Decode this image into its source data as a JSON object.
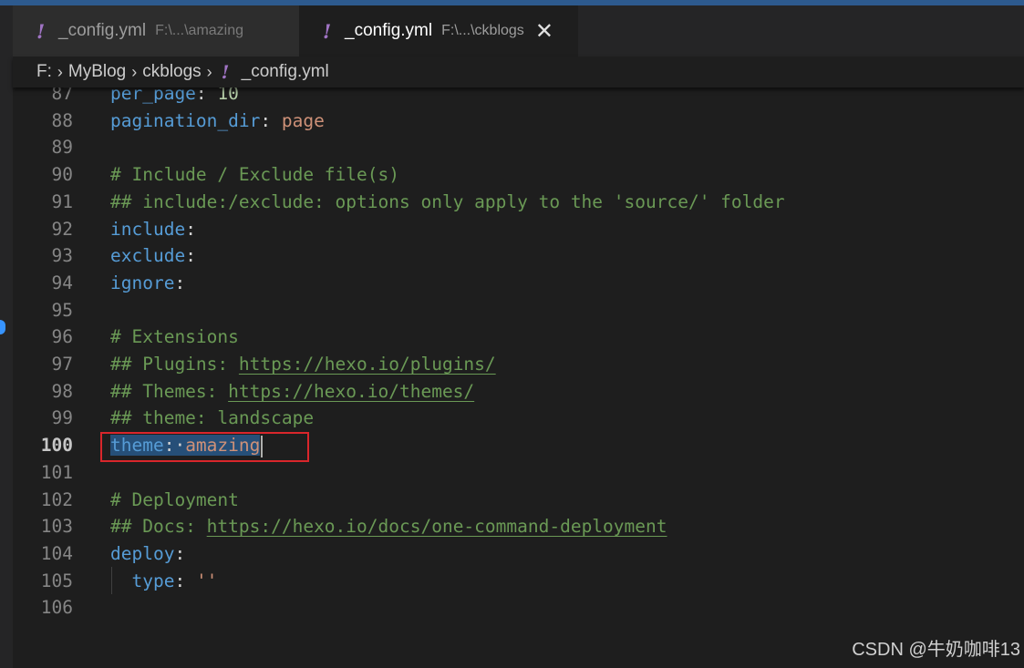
{
  "tabs": [
    {
      "name": "_config.yml",
      "description": "F:\\...\\amazing",
      "active": false
    },
    {
      "name": "_config.yml",
      "description": "F:\\...\\ckblogs",
      "active": true
    }
  ],
  "tab_close_glyph": "✕",
  "yml_icon_glyph": "!",
  "breadcrumb": {
    "items": [
      "F:",
      "MyBlog",
      "ckblogs"
    ],
    "file": "_config.yml",
    "separator": "›"
  },
  "editor": {
    "current_line": "100",
    "lines": [
      {
        "num": "87",
        "code": [
          {
            "t": "per_page",
            "c": "k"
          },
          {
            "t": ": ",
            "c": "p"
          },
          {
            "t": "10",
            "c": "n"
          }
        ]
      },
      {
        "num": "88",
        "code": [
          {
            "t": "pagination_dir",
            "c": "k"
          },
          {
            "t": ": ",
            "c": "p"
          },
          {
            "t": "page",
            "c": "s"
          }
        ]
      },
      {
        "num": "89",
        "code": []
      },
      {
        "num": "90",
        "code": [
          {
            "t": "# Include / Exclude file(s)",
            "c": "c"
          }
        ]
      },
      {
        "num": "91",
        "code": [
          {
            "t": "## include:/exclude: options only apply to the 'source/' folder",
            "c": "c"
          }
        ]
      },
      {
        "num": "92",
        "code": [
          {
            "t": "include",
            "c": "k"
          },
          {
            "t": ":",
            "c": "p"
          }
        ]
      },
      {
        "num": "93",
        "code": [
          {
            "t": "exclude",
            "c": "k"
          },
          {
            "t": ":",
            "c": "p"
          }
        ]
      },
      {
        "num": "94",
        "code": [
          {
            "t": "ignore",
            "c": "k"
          },
          {
            "t": ":",
            "c": "p"
          }
        ]
      },
      {
        "num": "95",
        "code": []
      },
      {
        "num": "96",
        "code": [
          {
            "t": "# Extensions",
            "c": "c"
          }
        ]
      },
      {
        "num": "97",
        "code": [
          {
            "t": "## Plugins: ",
            "c": "c"
          },
          {
            "t": "https://hexo.io/plugins/",
            "c": "u"
          }
        ]
      },
      {
        "num": "98",
        "code": [
          {
            "t": "## Themes: ",
            "c": "c"
          },
          {
            "t": "https://hexo.io/themes/",
            "c": "u"
          }
        ]
      },
      {
        "num": "99",
        "code": [
          {
            "t": "## theme: landscape",
            "c": "c"
          }
        ]
      },
      {
        "num": "100",
        "code": [
          {
            "t": "theme",
            "c": "k sel"
          },
          {
            "t": ":·",
            "c": "p sel"
          },
          {
            "t": "amazing",
            "c": "s sel"
          }
        ],
        "cursor": true
      },
      {
        "num": "101",
        "code": []
      },
      {
        "num": "102",
        "code": [
          {
            "t": "# Deployment",
            "c": "c"
          }
        ]
      },
      {
        "num": "103",
        "code": [
          {
            "t": "## Docs: ",
            "c": "c"
          },
          {
            "t": "https://hexo.io/docs/one-command-deployment",
            "c": "u"
          }
        ]
      },
      {
        "num": "104",
        "code": [
          {
            "t": "deploy",
            "c": "k"
          },
          {
            "t": ":",
            "c": "p"
          }
        ]
      },
      {
        "num": "105",
        "code": [
          {
            "t": "  ",
            "c": "p"
          },
          {
            "t": "type",
            "c": "k"
          },
          {
            "t": ": ",
            "c": "p"
          },
          {
            "t": "''",
            "c": "s"
          }
        ]
      },
      {
        "num": "106",
        "code": []
      }
    ]
  },
  "watermark": "CSDN @牛奶咖啡13",
  "colors": {
    "keyword": "#569cd6",
    "string": "#ce9178",
    "number": "#b5cea8",
    "comment": "#6a9955",
    "selection": "#264f78",
    "highlight_box": "#d9262b",
    "yml_icon": "#a074c4"
  }
}
